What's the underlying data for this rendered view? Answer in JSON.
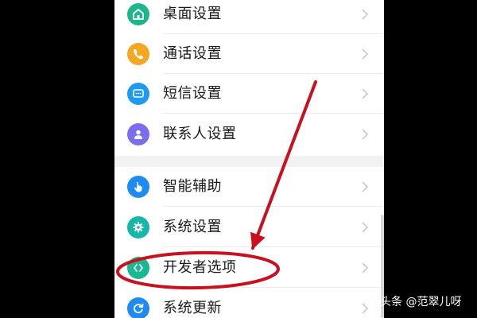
{
  "settings": {
    "items": [
      {
        "label": "桌面设置",
        "icon": "home-icon",
        "color": "#1DB58B"
      },
      {
        "label": "通话设置",
        "icon": "phone-icon",
        "color": "#F5A623"
      },
      {
        "label": "短信设置",
        "icon": "message-icon",
        "color": "#1E9BF0"
      },
      {
        "label": "联系人设置",
        "icon": "contact-icon",
        "color": "#7B6CF0"
      },
      {
        "label": "智能辅助",
        "icon": "gesture-hand-icon",
        "color": "#1E8BF0"
      },
      {
        "label": "系统设置",
        "icon": "gear-icon",
        "color": "#16B7A8"
      },
      {
        "label": "开发者选项",
        "icon": "code-brackets-icon",
        "color": "#19B892"
      },
      {
        "label": "系统更新",
        "icon": "refresh-icon",
        "color": "#1E8BF0"
      }
    ]
  },
  "annotation": {
    "color": "#C8101E"
  },
  "watermark": {
    "text": "头条 @范翠儿呀"
  }
}
